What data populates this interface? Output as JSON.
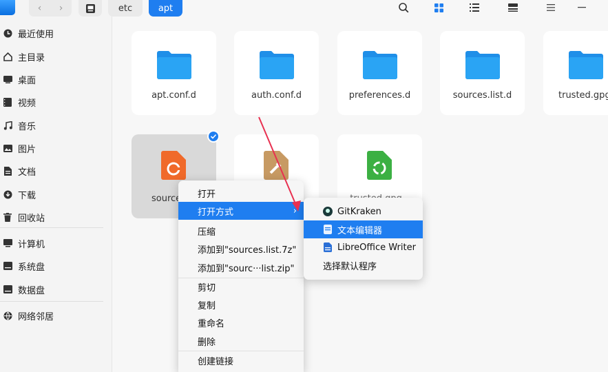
{
  "breadcrumb": {
    "home_icon": "disk-icon",
    "items": [
      "etc",
      "apt"
    ]
  },
  "toolbar": {
    "icons": [
      "search-icon",
      "grid-view-icon",
      "list-view-icon",
      "detail-view-icon",
      "menu-icon",
      "minimize-icon"
    ]
  },
  "sidebar": {
    "items": [
      {
        "label": "最近使用",
        "icon": "recent-icon"
      },
      {
        "label": "主目录",
        "icon": "home-icon"
      },
      {
        "label": "桌面",
        "icon": "desktop-icon"
      },
      {
        "label": "视频",
        "icon": "video-icon"
      },
      {
        "label": "音乐",
        "icon": "music-icon"
      },
      {
        "label": "图片",
        "icon": "picture-icon"
      },
      {
        "label": "文档",
        "icon": "document-icon"
      },
      {
        "label": "下载",
        "icon": "download-icon"
      },
      {
        "label": "回收站",
        "icon": "trash-icon"
      },
      {
        "label": "计算机",
        "icon": "computer-icon"
      },
      {
        "label": "系统盘",
        "icon": "system-disk-icon"
      },
      {
        "label": "数据盘",
        "icon": "data-disk-icon"
      },
      {
        "label": "网络邻居",
        "icon": "network-icon"
      }
    ]
  },
  "files": [
    {
      "name": "apt.conf.d",
      "type": "folder"
    },
    {
      "name": "auth.conf.d",
      "type": "folder"
    },
    {
      "name": "preferences.d",
      "type": "folder"
    },
    {
      "name": "sources.list.d",
      "type": "folder"
    },
    {
      "name": "trusted.gpg.d",
      "type": "folder"
    },
    {
      "name": "source",
      "type": "file"
    },
    {
      "name": "",
      "type": "file"
    },
    {
      "name": "trusted.gpg~",
      "type": "file"
    }
  ],
  "context_menu": {
    "items": [
      "打开",
      "打开方式",
      "压缩",
      "添加到\"sources.list.7z\"",
      "添加到\"sourc···list.zip\"",
      "剪切",
      "复制",
      "重命名",
      "删除",
      "创建链接"
    ],
    "highlighted": "打开方式"
  },
  "submenu": {
    "items": [
      "GitKraken",
      "文本编辑器",
      "LibreOffice Writer",
      "选择默认程序"
    ],
    "highlighted": "文本编辑器"
  },
  "colors": {
    "accent": "#1f7ef0",
    "folder": "#2a9bf0"
  }
}
